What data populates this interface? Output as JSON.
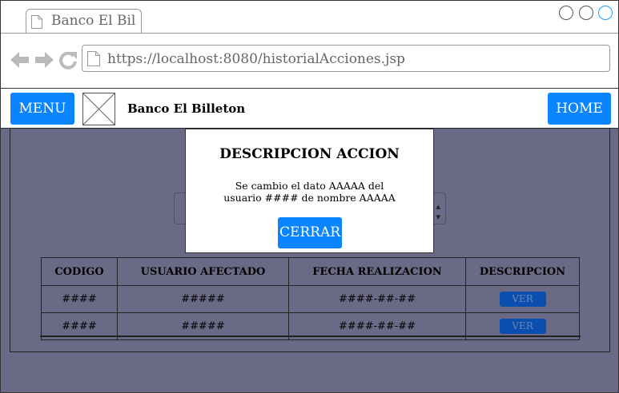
{
  "browser": {
    "tab_title": "Banco El Bil",
    "url": "https://localhost:8080/historialAcciones.jsp",
    "icons": [
      "page-icon",
      "back-arrow-icon",
      "forward-arrow-icon",
      "reload-icon"
    ]
  },
  "header": {
    "menu_label": "MENU",
    "bank_name": "Banco El Billeton",
    "home_label": "HOME"
  },
  "table": {
    "columns": [
      "CODIGO",
      "USUARIO AFECTADO",
      "FECHA REALIZACION",
      "DESCRIPCION"
    ],
    "rows": [
      {
        "codigo": "####",
        "usuario": "#####",
        "fecha": "####-##-##",
        "action": "VER"
      },
      {
        "codigo": "####",
        "usuario": "#####",
        "fecha": "####-##-##",
        "action": "VER"
      }
    ]
  },
  "modal": {
    "title": "DESCRIPCION ACCION",
    "line1": "Se cambio el dato AAAAA del",
    "line2": "usuario #### de nombre AAAAA",
    "close_label": "CERRAR"
  },
  "colors": {
    "accent": "#0a84ff",
    "overlay": "#6a6a86",
    "window_button_active": "#1e9bff"
  }
}
